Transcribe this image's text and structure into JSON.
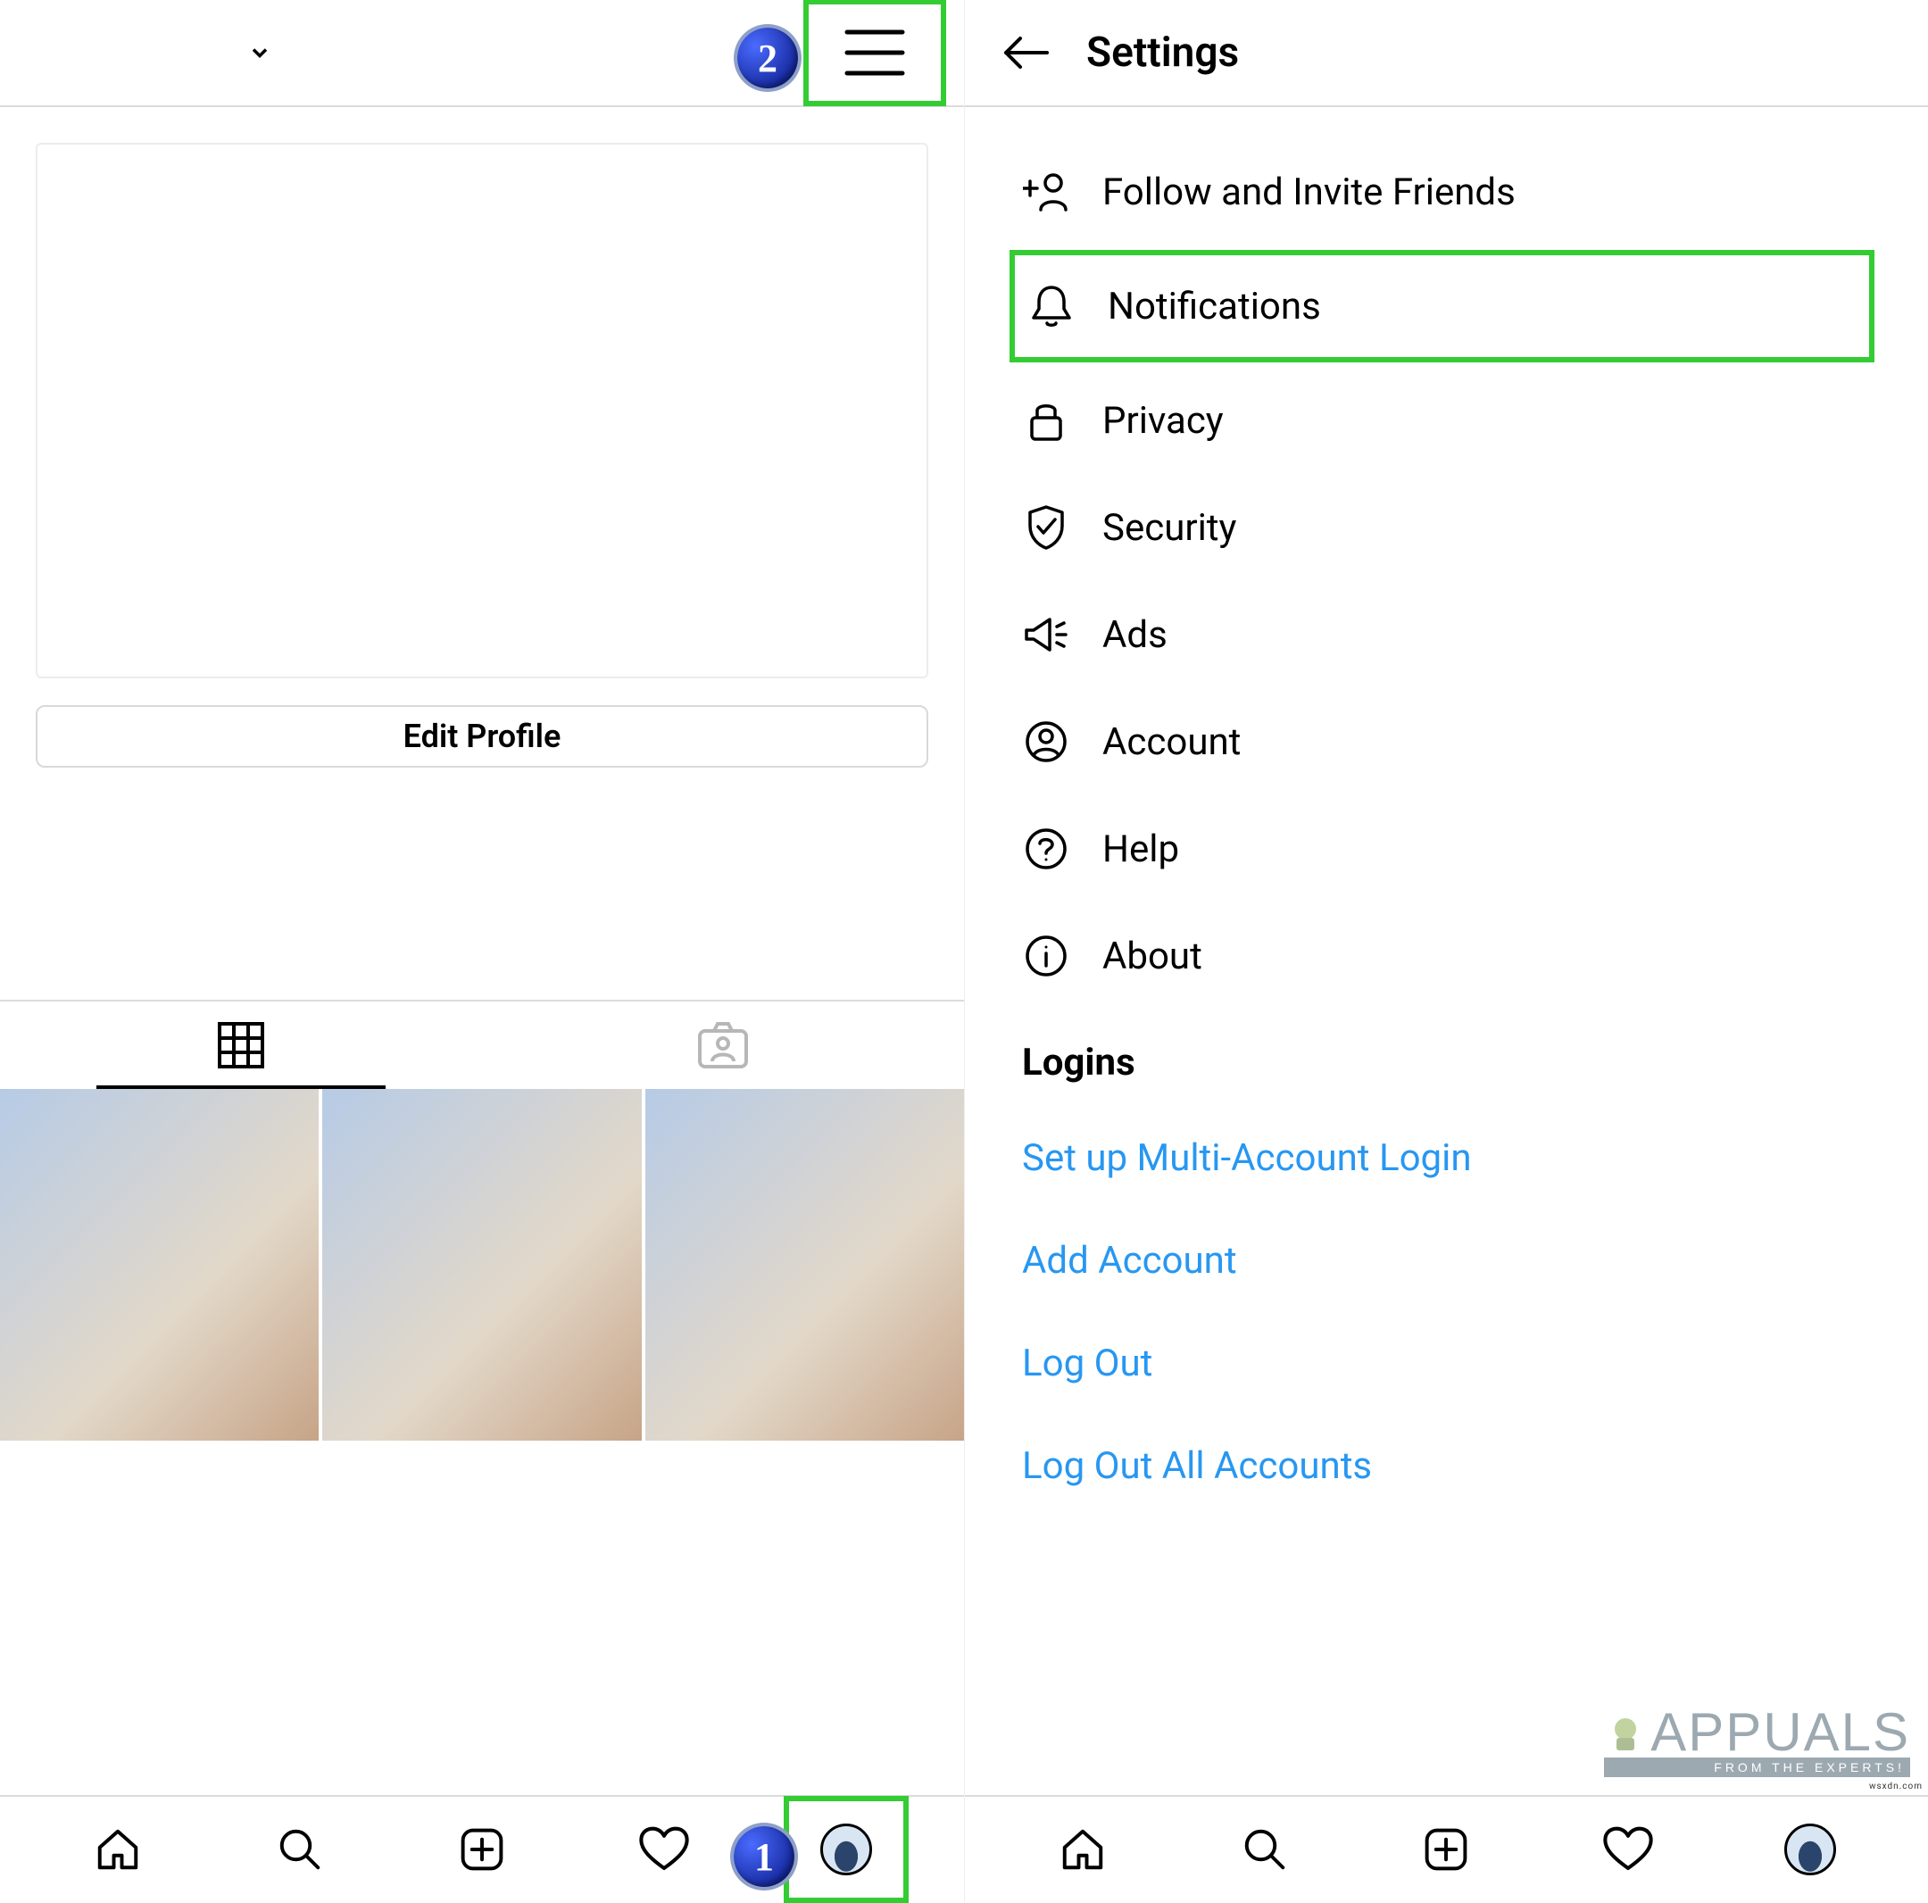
{
  "annotations": {
    "badge1": "1",
    "badge2": "2"
  },
  "profile": {
    "edit_button": "Edit Profile"
  },
  "settings": {
    "title": "Settings",
    "items": [
      {
        "icon": "invite",
        "label": "Follow and Invite Friends",
        "highlight": false
      },
      {
        "icon": "bell",
        "label": "Notifications",
        "highlight": true
      },
      {
        "icon": "lock",
        "label": "Privacy",
        "highlight": false
      },
      {
        "icon": "shield",
        "label": "Security",
        "highlight": false
      },
      {
        "icon": "ads",
        "label": "Ads",
        "highlight": false
      },
      {
        "icon": "account",
        "label": "Account",
        "highlight": false
      },
      {
        "icon": "help",
        "label": "Help",
        "highlight": false
      },
      {
        "icon": "about",
        "label": "About",
        "highlight": false
      }
    ],
    "logins_heading": "Logins",
    "login_links": [
      "Set up Multi-Account Login",
      "Add Account",
      "Log Out",
      "Log Out All Accounts"
    ]
  },
  "watermark": {
    "brand": "APPUALS",
    "tagline": "FROM THE EXPERTS!",
    "credit": "wsxdn.com"
  }
}
